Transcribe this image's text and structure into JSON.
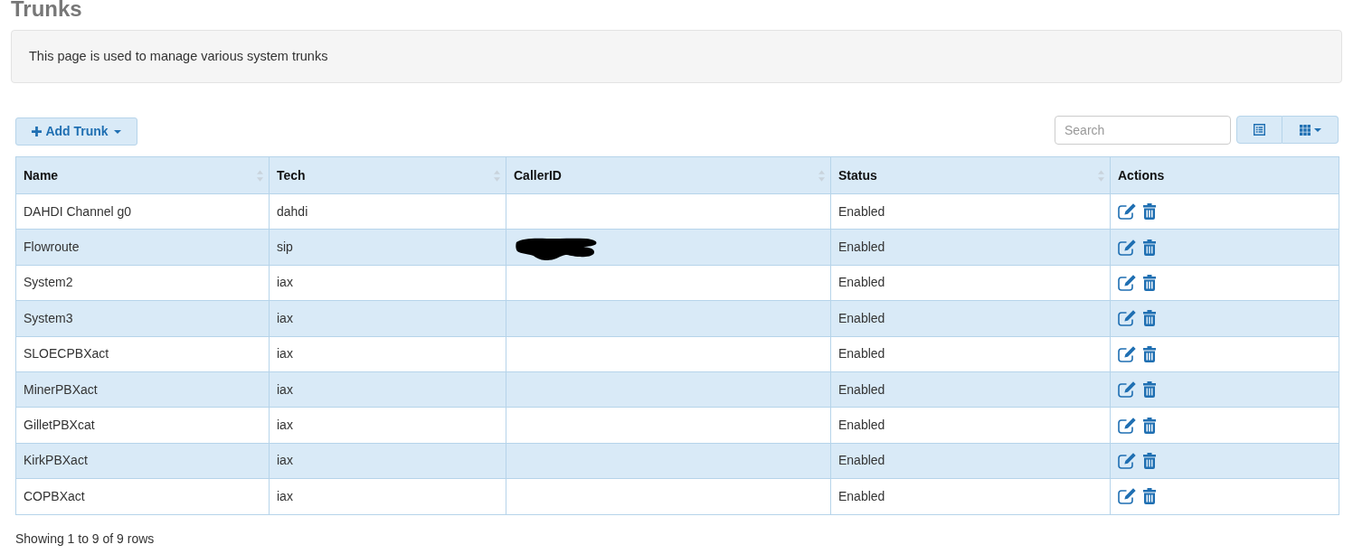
{
  "page": {
    "title": "Trunks"
  },
  "info_panel": {
    "text": "This page is used to manage various system trunks"
  },
  "toolbar": {
    "add_button": {
      "label": "Add Trunk"
    },
    "search": {
      "placeholder": "Search"
    }
  },
  "table": {
    "columns": [
      {
        "label": "Name",
        "sortable": true
      },
      {
        "label": "Tech",
        "sortable": true
      },
      {
        "label": "CallerID",
        "sortable": true
      },
      {
        "label": "Status",
        "sortable": true
      },
      {
        "label": "Actions",
        "sortable": false
      }
    ],
    "rows": [
      {
        "name": "DAHDI Channel g0",
        "tech": "dahdi",
        "callerid_redacted": false,
        "status": "Enabled"
      },
      {
        "name": "Flowroute",
        "tech": "sip",
        "callerid_redacted": true,
        "status": "Enabled"
      },
      {
        "name": "System2",
        "tech": "iax",
        "callerid_redacted": false,
        "status": "Enabled"
      },
      {
        "name": "System3",
        "tech": "iax",
        "callerid_redacted": false,
        "status": "Enabled"
      },
      {
        "name": "SLOECPBXact",
        "tech": "iax",
        "callerid_redacted": false,
        "status": "Enabled"
      },
      {
        "name": "MinerPBXact",
        "tech": "iax",
        "callerid_redacted": false,
        "status": "Enabled"
      },
      {
        "name": "GilletPBXcat",
        "tech": "iax",
        "callerid_redacted": false,
        "status": "Enabled"
      },
      {
        "name": "KirkPBXact",
        "tech": "iax",
        "callerid_redacted": false,
        "status": "Enabled"
      },
      {
        "name": "COPBXact",
        "tech": "iax",
        "callerid_redacted": false,
        "status": "Enabled"
      }
    ]
  },
  "footer": {
    "pagination": "Showing 1 to 9 of 9 rows"
  }
}
